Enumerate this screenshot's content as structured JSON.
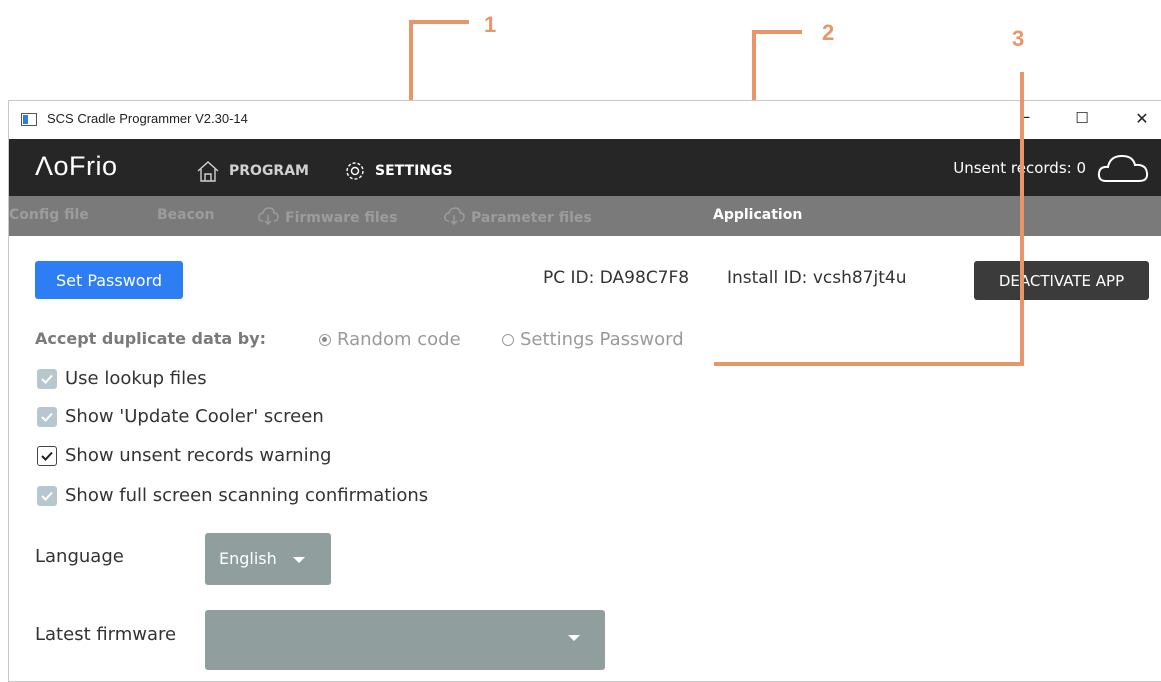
{
  "annotations": [
    "1",
    "2",
    "3"
  ],
  "window": {
    "title": "SCS Cradle Programmer V2.30-14",
    "minimize": "–",
    "maximize": "☐",
    "close": "✕"
  },
  "header": {
    "logo": "ΛoFrio",
    "nav": [
      {
        "label": "PROGRAM",
        "icon": "home-icon"
      },
      {
        "label": "SETTINGS",
        "icon": "gear-icon"
      }
    ],
    "unsent_records": "Unsent records: 0",
    "cloud_icon": "cloud-icon"
  },
  "subnav": [
    {
      "label": "Config file"
    },
    {
      "label": "Beacon"
    },
    {
      "label": "Firmware files",
      "icon": "cloud-download-icon"
    },
    {
      "label": "Parameter files",
      "icon": "cloud-download-icon"
    },
    {
      "label": "Application",
      "active": true
    }
  ],
  "application": {
    "set_password": "Set Password",
    "pc_id": "PC ID: DA98C7F8",
    "install_id": "Install ID: vcsh87jt4u",
    "deactivate": "DEACTIVATE APP",
    "accept_label": "Accept duplicate data by:",
    "radio_options": [
      {
        "label": "Random code",
        "selected": true
      },
      {
        "label": "Settings Password",
        "selected": false
      }
    ],
    "checkboxes": [
      {
        "label": "Use lookup files",
        "checked": true,
        "enabled": false
      },
      {
        "label": "Show 'Update Cooler' screen",
        "checked": true,
        "enabled": false
      },
      {
        "label": "Show unsent records warning",
        "checked": true,
        "enabled": true
      },
      {
        "label": "Show full screen scanning confirmations",
        "checked": true,
        "enabled": false
      }
    ],
    "language_label": "Language",
    "language_value": "English",
    "firmware_label": "Latest firmware",
    "firmware_value": ""
  },
  "colors": {
    "annotation": "#e8956a",
    "header_bg": "#262626",
    "subnav_bg": "#7a7a7a",
    "primary": "#2d7ef2",
    "dark_button": "#3b3b3b",
    "select_bg": "#909e9e"
  }
}
